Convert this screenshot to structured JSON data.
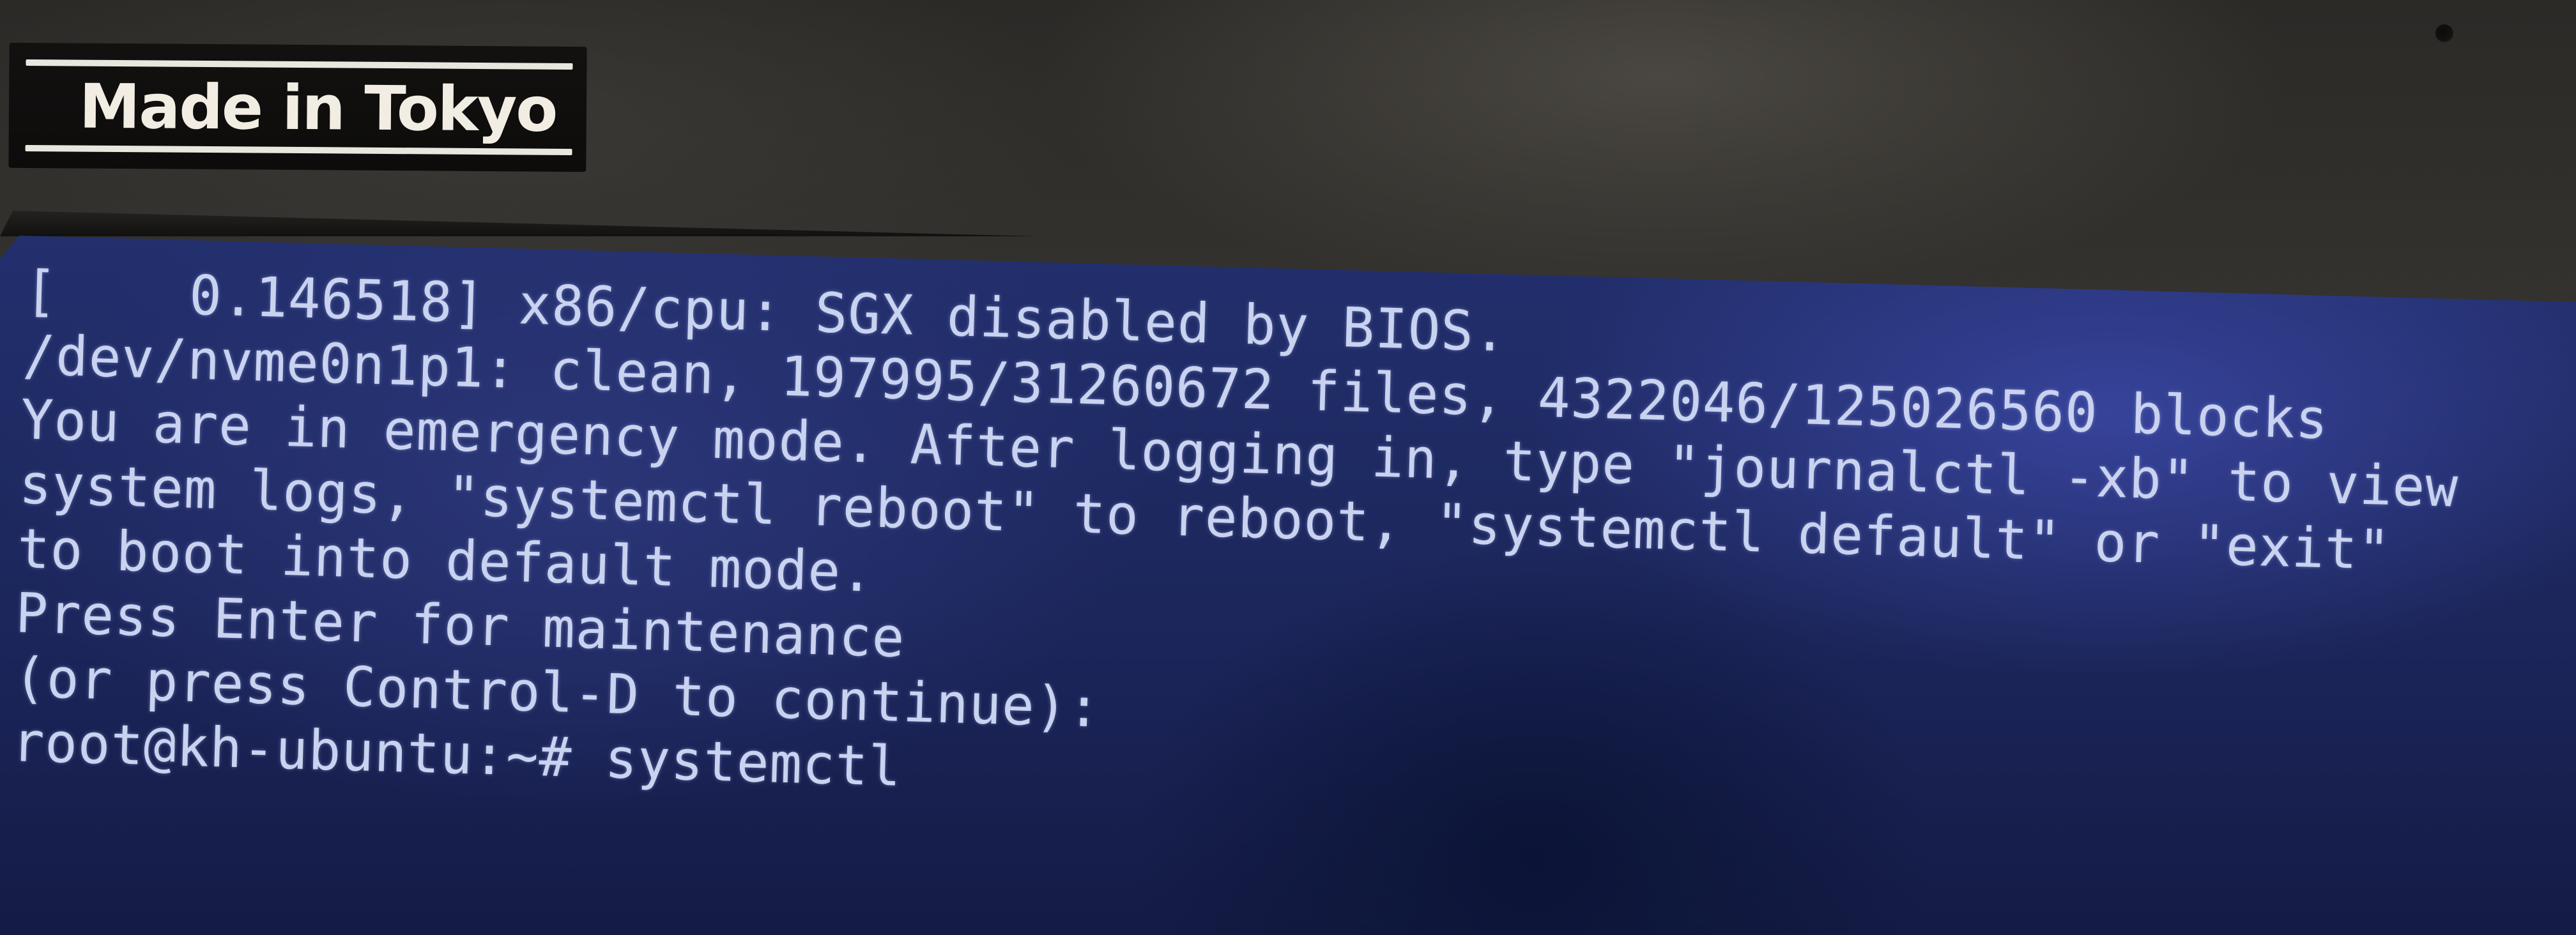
{
  "sticker": {
    "text": "Made in Tokyo"
  },
  "terminal": {
    "lines": [
      "[    0.146518] x86/cpu: SGX disabled by BIOS.",
      "/dev/nvme0n1p1: clean, 197995/31260672 files, 4322046/125026560 blocks",
      "You are in emergency mode. After logging in, type \"journalctl -xb\" to view",
      "system logs, \"systemctl reboot\" to reboot, \"systemctl default\" or \"exit\"",
      "to boot into default mode.",
      "Press Enter for maintenance",
      "(or press Control-D to continue):",
      "root@kh-ubuntu:~# systemctl"
    ]
  },
  "colors": {
    "screen_bg": "#1f2a66",
    "text": "#c9d2ef",
    "bezel": "#2f2d2a"
  }
}
